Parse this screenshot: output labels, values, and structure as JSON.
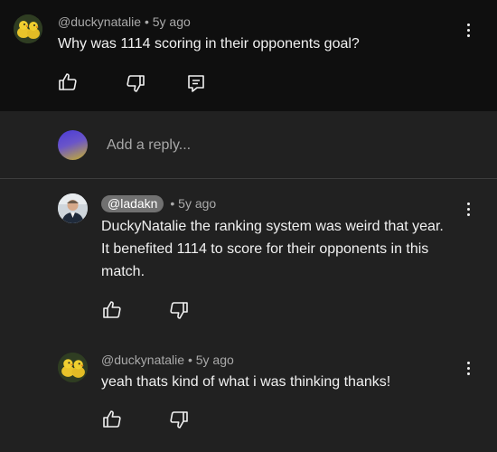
{
  "top_comment": {
    "handle": "@duckynatalie",
    "time": "5y ago",
    "text": "Why was 1114 scoring in their opponents goal?",
    "avatar_icon": "duck-avatar-icon"
  },
  "reply_box": {
    "placeholder": "Add a reply..."
  },
  "replies": [
    {
      "handle": "@ladakn",
      "time": "5y ago",
      "text_lines": [
        "DuckyNatalie the ranking system was weird that year.",
        "It benefited 1114 to score for their opponents in this",
        "match."
      ],
      "avatar_icon": "person-avatar-icon"
    },
    {
      "handle": "@duckynatalie",
      "time": "5y ago",
      "text": "yeah thats kind of what i was thinking thanks!",
      "avatar_icon": "duck-avatar-icon"
    }
  ],
  "separator_dot": "•",
  "colors": {
    "top_bg": "#0f0f0f",
    "panel_bg": "#212121",
    "chip_bg": "#717171",
    "meta_text": "#aaaaaa"
  }
}
